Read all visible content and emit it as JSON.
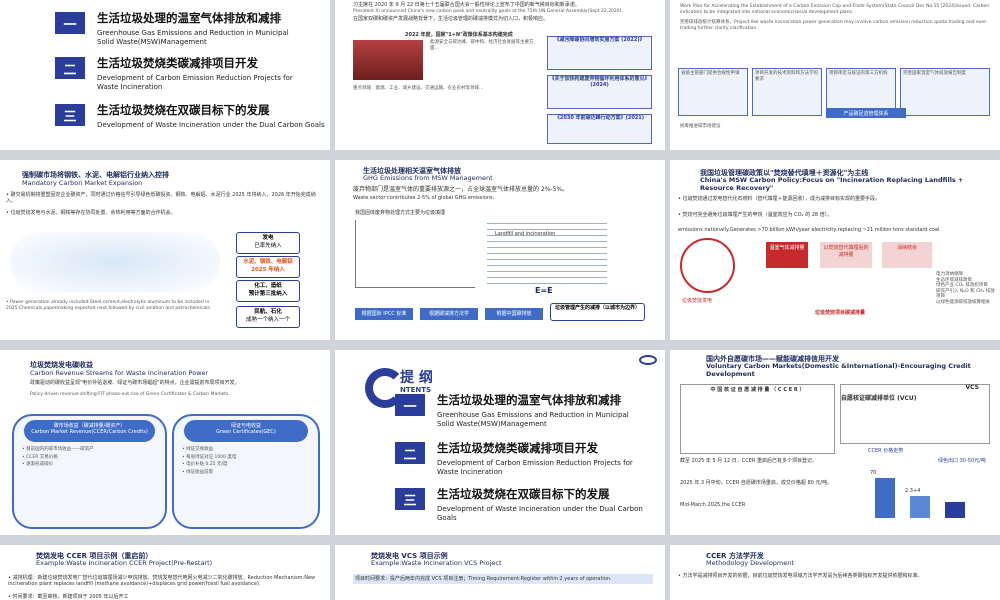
{
  "agenda_a": {
    "items": [
      {
        "num": "一",
        "zh": "生活垃圾处理的温室气体排放和减排",
        "en": "Greenhouse Gas Emissions and Reduction in Municipal Solid Waste(MSW)Management"
      },
      {
        "num": "二",
        "zh": "生活垃圾焚烧类碳减排项目开发",
        "en": "Development of Carbon Emission Reduction Projects for Waste Incineration"
      },
      {
        "num": "三",
        "zh": "生活垃圾焚烧在双碳目标下的发展",
        "en": "Development of Waste Incineration under the Dual Carbon Goals"
      }
    ]
  },
  "policy_slide": {
    "line1": "习主席在 2020 年 9 月 22 日第七十五届联合国大会一般性辩论上宣布了中国的新气候目标和新承诺。",
    "line2": "President Xi announced China's new carbon peak and neutrality goals at the 75th UN General Assembly(Sept 22,2020).",
    "line3": "在国家双碳和碳资产发展战略背景下，生活垃圾管理的碳减排模式为切入口，积极响应。",
    "box1_title": "2022 年度，国家\"1+N\"政策体系基本构建完成",
    "box2_title": "《关于加快构建废弃物循环利用体系的意见》(2024)",
    "box3_title": "《2030 年前碳达峰行动方案》(2021)",
    "side1": "《减污降碳协同增效实施方案 (2022)》",
    "caption": "2022 年度，国家\"1+N\"政策体系基本构建完成"
  },
  "work_plan": {
    "text1": "Work Plan for Accelerating the Establishment of a Carbon Emission Cap-and-Trade System(State Council Dec No.15 [2024]issued. Carbon indicators to be integrated into national economic/social development plans.",
    "text2": "完善碳排放统计核算体系，Project like waste incineration power generation may involve carbon emission reduction quota trading and ever-trading further clarity clarification.",
    "boxes": [
      "省级主管部门提供合规性申请",
      "项目开发的技术资料和方法学的要求",
      "项目审定与核证的第三方机构",
      "完善国家温室气体排放报告制度"
    ],
    "bar_label": "产品碳足迹管理体系",
    "footnote": "统筹推进碳市场建设"
  },
  "mandatory": {
    "title_zh": "强制碳市场将钢铁、水泥、电解铝行业纳入控排",
    "title_en": "Mandatory Carbon Market Expansion",
    "bullet1": "碳交易机制将重塑固定企业碳资产，同时通过价格信号引导绿色低碳投资。钢铁、电解铝、水泥行业 2025 年将纳入，2026 年开始完成纳入。",
    "bullet2": "垃圾焚烧发电与水泥、钢铁等存在协同处置、余热利用等方面的合作机会。",
    "en_bullet": "Power generation already included.Steel,cement,electrolytic aluminum to be included in 2025.Chemicals,papermaking expected next,followed by civil aviation and petrochemicals.",
    "stage1": "发电",
    "stage1b": "已率先纳入",
    "stage2": "水泥、钢铁、电解铝",
    "stage2b": "2025 年纳入",
    "stage3": "化工、造纸",
    "stage3b": "预计第三批纳入",
    "stage4": "民航、石化",
    "stage4b": "成熟一个纳入一个"
  },
  "ghg": {
    "title_zh": "生活垃圾处理相关温室气体排放",
    "title_en": "GHG Emissions from MSW Management",
    "text_zh": "废弃物部门是温室气体的重要排放源之一，占全球温室气体排放总量的 2%-5%。",
    "text_en": "Waste sector contributes 2-5% of global GHG emissions.",
    "table_title": "我国固体废弃物处理方式主要为垃圾填埋",
    "chart_label": "Landfill and incineration",
    "formula": "E=E",
    "box1": "根据国际 IPCC 标准",
    "box2": "根据碳减排方法学",
    "box3": "根据中国碳排放",
    "footer": "垃圾管理产生的减排（以城市为边界）"
  },
  "china_policy": {
    "title_zh": "我国垃圾管理碳政策以\"焚烧替代填埋＋资源化\"为主线",
    "title_en": "China's MSW Carbon Policy:Focus on \"Incineration Replacing Landfills + Resource Recovery\"",
    "b1": "垃圾焚烧通过发电替代化石燃料（替代填埋＋能源回收），成为减排目标实现的重要手段。",
    "b2": "焚烧可完全避免垃圾填埋产生的甲烷（温室效应为 CO₂ 的 28 倍）。",
    "en": "emissions nationally.Generates >70 billion kWh/year electricity,replacing ~21 million tons standard coal.",
    "left1": "垃圾焚烧发电",
    "mid1": "温室气体减排量",
    "mid2": "以焚烧替代填埋后的减排量",
    "right": "消纳结余",
    "items": [
      "电力消纳保障",
      "生态环境减排政策",
      "绿色产业 CO₂ 排放权项目",
      "碳资产引入 N₂O 和 CH₄ 排放项目",
      "以绿色能源碳排放核算相关"
    ],
    "foot": "垃圾焚烧项目碳减排量"
  },
  "revenue": {
    "title_zh": "垃圾焚烧发电碳收益",
    "title_en": "Carbon Revenue Streams for Waste Incineration Power",
    "intro": "政策驱动的碳收益呈现\"电价补贴退坡、绿证与碳市场崛起\"的特点，企业需提前布局项目开发。",
    "intro_en": "Policy-driven revenue shifting:FIT phase-out,rise of Green Certificates & Carbon Markets.",
    "left_title": "碳市场收益（碳减排量/碳资产）",
    "left_en": "Carbon Market Revenue(CCER/Carbon Credits)",
    "right_title": "绿证与电收益",
    "right_en": "Green Certificates(GEC)",
    "left_items": [
      "目前国内的碳市场收益——碳资产",
      "CCER 交易价格",
      "逐渐形成碳价"
    ],
    "right_items": [
      "绿证交易收益",
      "每张绿证对应 1000 度电",
      "电价补贴 0.25 元/度",
      "绿证收益前景"
    ]
  },
  "agenda_b": {
    "heading_zh": "提  纲",
    "heading_en": "NTENTS",
    "items": [
      {
        "num": "一",
        "zh": "生活垃圾处理的温室气体排放和减排",
        "en": "Greenhouse Gas Emissions and Reduction in Municipal Solid Waste(MSW)Management"
      },
      {
        "num": "二",
        "zh": "生活垃圾焚烧类碳减排项目开发",
        "en": "Development of Carbon Emission Reduction Projects for Waste Incineration"
      },
      {
        "num": "三",
        "zh": "生活垃圾焚烧在双碳目标下的发展",
        "en": "Development of Waste Incineration under the Dual Carbon Goals"
      }
    ]
  },
  "voluntary": {
    "title_zh": "国内外自愿碳市场——赋能碳减排信用开发",
    "title_en": "Voluntary Carbon Markets(Domestic &International)-Encouraging Credit Development",
    "doc_left": "中 国 核 证 自 愿 减 排 量 （ C C E R ）",
    "doc_right_zh": "自愿核证碳减排单位 (VCU)",
    "doc_right_en": "VCS",
    "body1": "截至 2025 年 5 月 12 日，CCER 重启后已有多个项目登记。",
    "body2": "2025 年 3 月中旬，CCER 自愿碳市场重启，成交价格超 80 元/吨。",
    "chart_title": "CCER 价格走势",
    "bars": [
      {
        "label": "CCER",
        "value": "70"
      },
      {
        "label": "VCS",
        "value": "2.3+4"
      }
    ],
    "note": "绿色出口 30-50元/吨",
    "foot_note": "Mid-March 2025,the CCER"
  },
  "ccer_example": {
    "title_zh": "焚烧发电 CCER 项目示例（重启前）",
    "title_en": "Example:Waste Incineration CCER Project(Pre-Restart)",
    "b1": "减排机理：新建垃圾焚烧发电厂替代垃圾填埋场减少甲烷排放。焚烧发电替代电网火电减少二氧化碳排放。Reduction Mechanism:New incineration plant replaces landfill (methane avoidance)+displaces grid power(fossil fuel avoidance).",
    "b2": "时间要求：截至审核，新建项目于 2005 年以后开工"
  },
  "vcs_example": {
    "title_zh": "焚烧发电 VCS 项目示例",
    "title_en": "Example:Waste Incineration VCS Project",
    "row1": "项目时间要求：投产后两年内完成 VCS 项目注册；Timing Requirement:Register within 2 years of operation."
  },
  "methodology": {
    "title_zh": "CCER 方法学开发",
    "title_en": "Methodology Development",
    "b1": "方法学是减排项目开发的依据，目前垃圾焚烧发电领域方法学开发是为后续各类碳指标开发提供依据和标准。"
  }
}
